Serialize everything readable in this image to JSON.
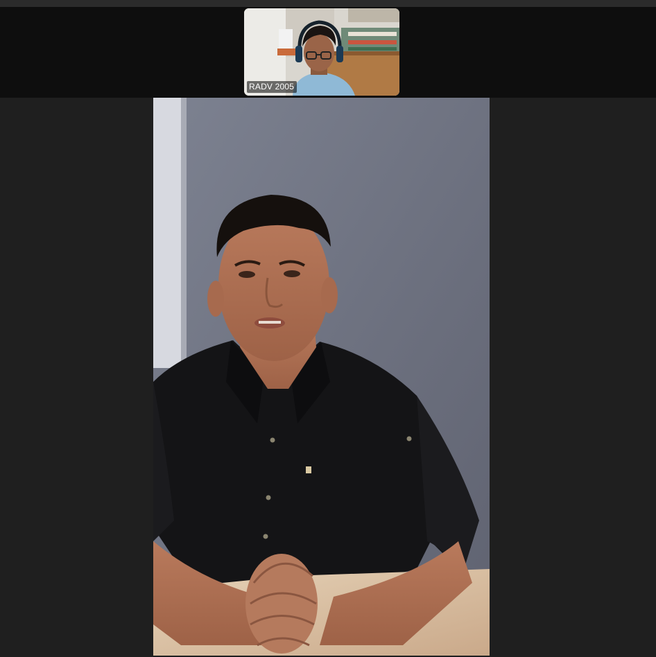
{
  "meeting": {
    "participants": [
      {
        "name": "RADV 2005",
        "role": "thumbnail"
      },
      {
        "name": "",
        "role": "active-speaker"
      }
    ]
  },
  "colors": {
    "filmstrip_bg": "#0e0e0e",
    "stage_bg": "#1f1f1f",
    "label_text": "#ffffff"
  }
}
